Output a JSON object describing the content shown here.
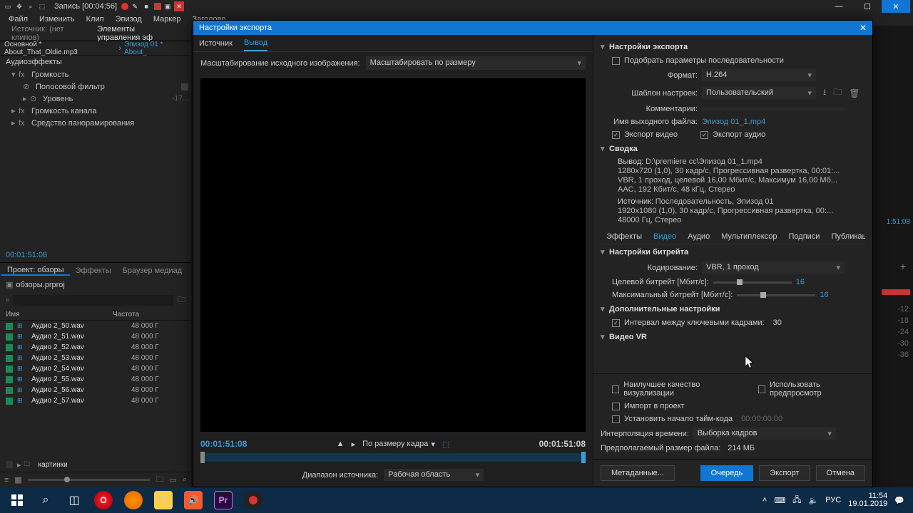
{
  "titlebar": {
    "title": "Запись [00:04:56]"
  },
  "menubar": [
    "Файл",
    "Изменить",
    "Клип",
    "Эпизод",
    "Маркер",
    "Заголово"
  ],
  "left": {
    "sourceTab": "Источник: (нет клипов)",
    "effectsTab": "Элементы управления эф",
    "sequence": {
      "main": "Основной * About_That_Oldie.mp3",
      "link": "Эпизод 01 * About_"
    },
    "fxHeader": "Аудиоэффекты",
    "fx": [
      {
        "name": "Громкость",
        "expanded": true
      },
      {
        "name": "Полосовой фильтр",
        "sub": true,
        "badge": true
      },
      {
        "name": "Уровень",
        "sub": true,
        "val": "-17..."
      },
      {
        "name": "Громкость канала"
      },
      {
        "name": "Средство панорамирования"
      }
    ],
    "miniTimecode": "00:01:51:08",
    "projectTabs": [
      "Проект: обзоры",
      "Эффекты",
      "Браузер медиад"
    ],
    "projectFile": "обзоры.prproj",
    "cols": {
      "name": "Имя",
      "freq": "Частота"
    },
    "files": [
      {
        "name": "Аудио 2_50.wav",
        "rate": "48 000 Г"
      },
      {
        "name": "Аудио 2_51.wav",
        "rate": "48 000 Г"
      },
      {
        "name": "Аудио 2_52.wav",
        "rate": "48 000 Г"
      },
      {
        "name": "Аудио 2_53.wav",
        "rate": "48 000 Г"
      },
      {
        "name": "Аудио 2_54.wav",
        "rate": "48 000 Г"
      },
      {
        "name": "Аудио 2_55.wav",
        "rate": "48 000 Г"
      },
      {
        "name": "Аудио 2_56.wav",
        "rate": "48 000 Г"
      },
      {
        "name": "Аудио 2_57.wav",
        "rate": "48 000 Г"
      }
    ],
    "folder": "картинки"
  },
  "rightPeek": {
    "tc": "1:51:08",
    "ticks": [
      "-12",
      "-18",
      "-24",
      "-30",
      "-36"
    ]
  },
  "modal": {
    "title": "Настройки экспорта",
    "tabs": {
      "source": "Источник",
      "output": "Вывод"
    },
    "scale": {
      "label": "Масштабирование исходного изображения:",
      "value": "Масштабировать по размеру"
    },
    "tcLeft": "00:01:51:08",
    "fit": "По размеру кадра",
    "tcRight": "00:01:51:08",
    "range": {
      "label": "Диапазон источника:",
      "value": "Рабочая область"
    }
  },
  "settings": {
    "header": "Настройки экспорта",
    "matchSeq": "Подобрать параметры последовательности",
    "format": {
      "label": "Формат:",
      "value": "H.264"
    },
    "preset": {
      "label": "Шаблон настроек:",
      "value": "Пользовательский"
    },
    "comments": {
      "label": "Комментарии:"
    },
    "outName": {
      "label": "Имя выходного файла:",
      "value": "Эпизод 01_1.mp4"
    },
    "exportVideo": "Экспорт видео",
    "exportAudio": "Экспорт аудио",
    "summaryHdr": "Сводка",
    "summary": {
      "out": {
        "k": "Вывод:",
        "l1": "D:\\premiere cc\\Эпизод 01_1.mp4",
        "l2": "1280x720 (1,0), 30 кадр/с, Прогрессивная развертка, 00:01:...",
        "l3": "VBR, 1 проход, целевой 16,00 Мбит/с, Максимум 16,00 Мб...",
        "l4": "AAC, 192 Кбит/с, 48 кГц, Стерео"
      },
      "src": {
        "k": "Источник:",
        "l1": "Последовательность, Эпизод 01",
        "l2": "1920x1080 (1,0), 30 кадр/с, Прогрессивная развертка, 00:...",
        "l3": "48000 Гц, Стерео"
      }
    },
    "tabs": [
      "Эффекты",
      "Видео",
      "Аудио",
      "Мультиплексор",
      "Подписи",
      "Публикац"
    ],
    "bitrate": {
      "hdr": "Настройки битрейта",
      "encoding": {
        "label": "Кодирование:",
        "value": "VBR, 1 проход"
      },
      "target": {
        "label": "Целевой битрейт [Мбит/с]:",
        "value": "16"
      },
      "max": {
        "label": "Максимальный битрейт [Мбит/с]:",
        "value": "16"
      }
    },
    "advanced": {
      "hdr": "Дополнительные настройки",
      "keyframe": {
        "label": "Интервал между ключевыми кадрами:",
        "value": "30"
      }
    },
    "vr": {
      "hdr": "Видео VR"
    },
    "maxQuality": "Наилучшее качество визуализации",
    "usePreview": "Использовать предпросмотр",
    "importProject": "Импорт в проект",
    "setStart": {
      "label": "Установить начало тайм-кода",
      "value": "00:00:00:00"
    },
    "interp": {
      "label": "Интерполяция времени:",
      "value": "Выборка кадров"
    },
    "estSize": {
      "label": "Предполагаемый размер файла:",
      "value": "214 МБ"
    },
    "buttons": {
      "meta": "Метаданные...",
      "queue": "Очередь",
      "export": "Экспорт",
      "cancel": "Отмена"
    }
  },
  "taskbar": {
    "lang": "РУС",
    "time": "11:54",
    "date": "19.01.2019"
  }
}
